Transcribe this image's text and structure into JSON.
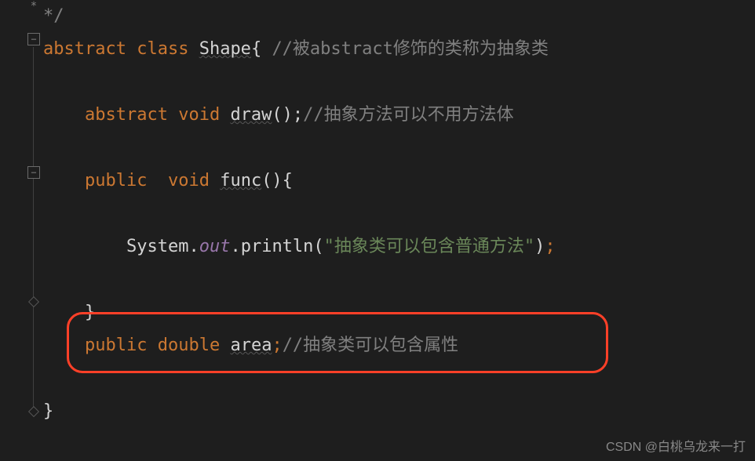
{
  "lines": {
    "l0": {
      "comment_end": "*/"
    },
    "l1": {
      "kw1": "abstract",
      "kw2": "class",
      "classname": "Shape",
      "brace_open": "{",
      "comment": "//被abstract修饰的类称为抽象类"
    },
    "l3": {
      "kw1": "abstract",
      "kw2": "void",
      "method": "draw",
      "parens": "();",
      "comment": "//抽象方法可以不用方法体"
    },
    "l5": {
      "kw1": "public",
      "kw2": "void",
      "method": "func",
      "parens": "(){",
      "brace": ""
    },
    "l7": {
      "obj": "System",
      "dot1": ".",
      "field": "out",
      "dot2": ".",
      "call": "println",
      "paren_open": "(",
      "str": "\"抽象类可以包含普通方法\"",
      "paren_close": ")",
      "semi": ";"
    },
    "l9": {
      "brace_close": "}"
    },
    "l10": {
      "kw1": "public",
      "kw2": "double",
      "field": "area",
      "semi": ";",
      "comment": "//抽象类可以包含属性"
    },
    "l12": {
      "brace_close": "}"
    }
  },
  "fold_markers": {
    "star": "*",
    "minus": "−",
    "diamond": ""
  },
  "watermark": "CSDN @白桃乌龙来一打"
}
